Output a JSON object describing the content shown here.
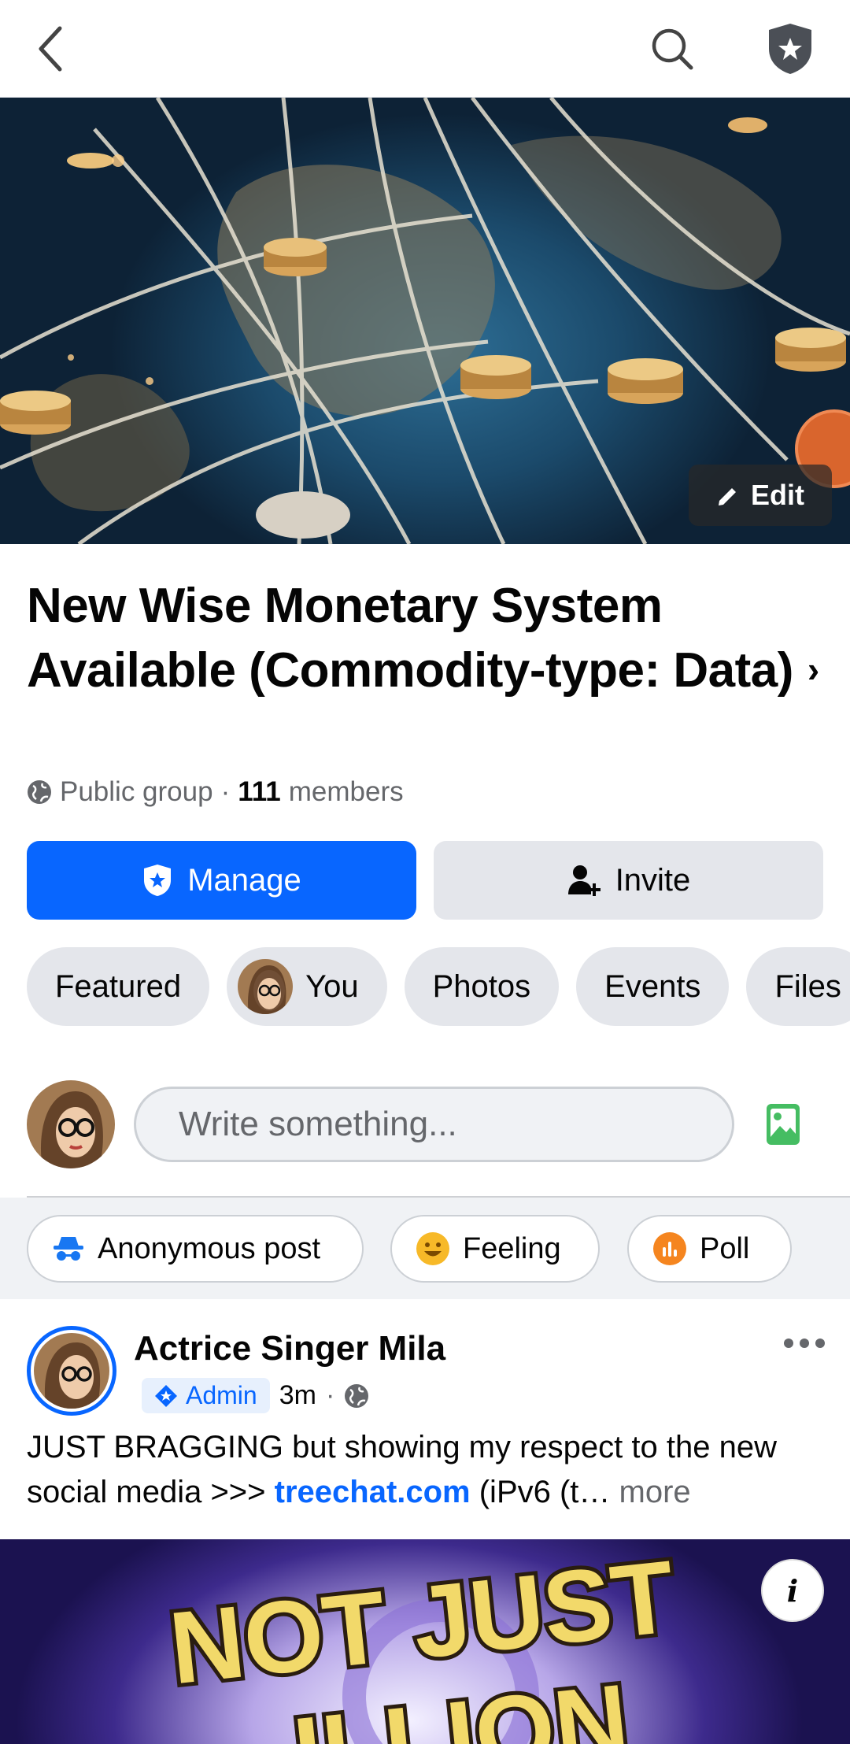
{
  "group": {
    "title": "New Wise Monetary System Available (Commodity-type: Data)",
    "privacy": "Public group",
    "separator": "·",
    "member_count": "111",
    "members_label": "members"
  },
  "cover": {
    "edit_label": "Edit"
  },
  "buttons": {
    "manage": "Manage",
    "invite": "Invite"
  },
  "chips": [
    "Featured",
    "You",
    "Photos",
    "Events",
    "Files"
  ],
  "composer": {
    "placeholder": "Write something..."
  },
  "actions": [
    "Anonymous post",
    "Feeling",
    "Poll"
  ],
  "post": {
    "author": "Actrice Singer Mila",
    "badge": "Admin",
    "time": "3m",
    "dot": "·",
    "text_before": "JUST BRAGGING but showing my respect to the new social media >>> ",
    "link": "treechat.com",
    "text_after": " (iPv6 (t…",
    "more": " more",
    "image_text": "NOT JUST",
    "image_text_2": "...ILLION"
  },
  "colors": {
    "brand": "#0866ff",
    "chip_bg": "#e4e6eb",
    "photo_icon": "#45bd62",
    "feeling": "#f7b928",
    "poll": "#f5851f"
  }
}
